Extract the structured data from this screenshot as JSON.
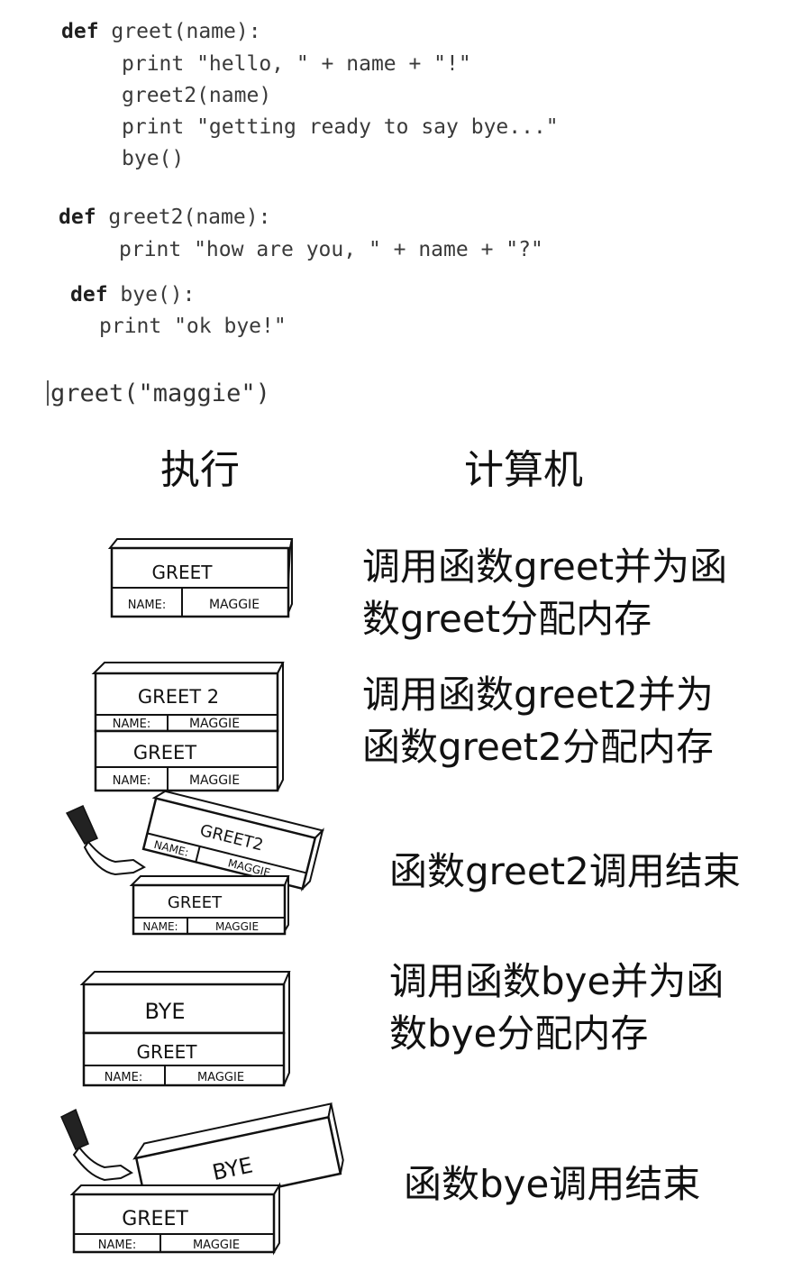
{
  "code": {
    "greet_def": {
      "keyword": "def",
      "signature": "greet(name):"
    },
    "greet_body": [
      "print \"hello, \" + name + \"!\"",
      "greet2(name)",
      "print \"getting ready to say bye...\"",
      "bye()"
    ],
    "greet2_def": {
      "keyword": "def",
      "signature": "greet2(name):"
    },
    "greet2_body": [
      "print \"how are you, \" + name + \"?\""
    ],
    "bye_def": {
      "keyword": "def",
      "signature": "bye():"
    },
    "bye_body": [
      "print \"ok bye!\""
    ],
    "call": "greet(\"maggie\")"
  },
  "headers": {
    "execution": "执行",
    "computer": "计算机"
  },
  "steps": [
    {
      "description": "调用函数greet并为函\n数greet分配内存",
      "frames": [
        {
          "name": "GREET",
          "var": "NAME:",
          "value": "MAGGIE"
        }
      ]
    },
    {
      "description": "调用函数greet2并为\n函数greet2分配内存",
      "frames": [
        {
          "name": "GREET 2",
          "var": "NAME:",
          "value": "MAGGIE"
        },
        {
          "name": "GREET",
          "var": "NAME:",
          "value": "MAGGIE"
        }
      ]
    },
    {
      "description": "函数greet2调用结束",
      "frames": [
        {
          "name": "GREET2",
          "var": "NAME:",
          "value": "MAGGIE"
        },
        {
          "name": "GREET",
          "var": "NAME:",
          "value": "MAGGIE"
        }
      ]
    },
    {
      "description": "调用函数bye并为函\n数bye分配内存",
      "frames": [
        {
          "name": "BYE"
        },
        {
          "name": "GREET",
          "var": "NAME:",
          "value": "MAGGIE"
        }
      ]
    },
    {
      "description": "函数bye调用结束",
      "frames": [
        {
          "name": "BYE"
        },
        {
          "name": "GREET",
          "var": "NAME:",
          "value": "MAGGIE"
        }
      ]
    }
  ]
}
